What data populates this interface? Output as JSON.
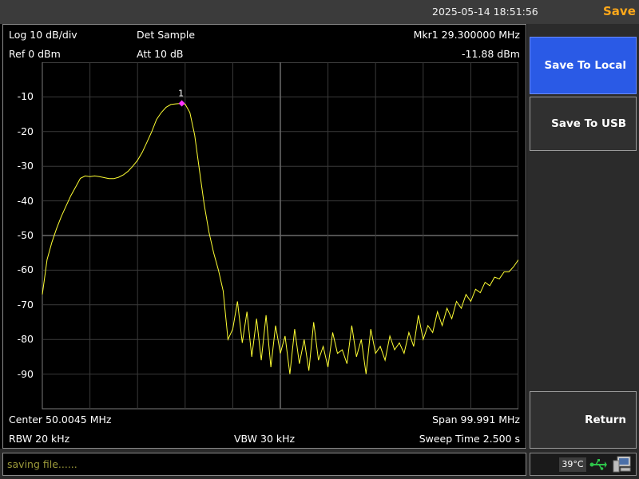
{
  "topbar": {
    "datetime": "2025-05-14 18:51:56",
    "menu_title": "Save"
  },
  "header": {
    "scale": "Log 10 dB/div",
    "detector": "Det Sample",
    "marker_label": "Mkr1  29.300000 MHz",
    "ref_level": "Ref 0 dBm",
    "attenuation": "Att 10 dB",
    "marker_value": "-11.88 dBm"
  },
  "footer": {
    "center": "Center 50.0045 MHz",
    "span": "Span 99.991 MHz",
    "rbw": "RBW 20 kHz",
    "vbw": "VBW 30 kHz",
    "sweep": "Sweep Time 2.500 s"
  },
  "softkeys": {
    "save_to_local": "Save To Local",
    "save_to_usb": "Save To USB",
    "return": "Return"
  },
  "status": {
    "message": "saving file......",
    "temperature": "39°C"
  },
  "icons": {
    "usb": "usb-icon",
    "pc": "computer-icon"
  },
  "colors": {
    "trace": "#ffff33",
    "marker": "#ff33ff",
    "accent": "#ffa81a",
    "selected_key": "#2a5ae6"
  },
  "chart_data": {
    "type": "line",
    "y_tick_labels": [
      "-10",
      "-20",
      "-30",
      "-40",
      "-50",
      "-60",
      "-70",
      "-80",
      "-90"
    ],
    "ylim": [
      -100,
      0
    ],
    "xlim_mhz": [
      0.009,
      100.0
    ],
    "grid": true,
    "marker": {
      "label": "1",
      "x_mhz": 29.3,
      "y_dbm": -11.88
    },
    "series": [
      {
        "x": [
          0.009,
          1,
          2,
          3,
          4,
          5,
          6,
          7,
          8,
          9,
          10,
          11,
          12,
          13,
          14,
          15,
          16,
          17,
          18,
          19,
          20,
          21,
          22,
          23,
          24,
          25,
          26,
          27,
          28,
          29,
          30,
          31,
          32,
          33,
          34,
          35,
          36,
          37,
          38,
          39,
          40,
          41,
          42,
          43,
          44,
          45,
          46,
          47,
          48,
          49,
          50,
          51,
          52,
          53,
          54,
          55,
          56,
          57,
          58,
          59,
          60,
          61,
          62,
          63,
          64,
          65,
          66,
          67,
          68,
          69,
          70,
          71,
          72,
          73,
          74,
          75,
          76,
          77,
          78,
          79,
          80,
          81,
          82,
          83,
          84,
          85,
          86,
          87,
          88,
          89,
          90,
          91,
          92,
          93,
          94,
          95,
          96,
          97,
          98,
          99,
          100
        ],
        "y": [
          -67,
          -57,
          -52,
          -48,
          -44.5,
          -41.5,
          -38.5,
          -36,
          -33.5,
          -32.8,
          -33,
          -32.8,
          -33,
          -33.3,
          -33.6,
          -33.6,
          -33.2,
          -32.5,
          -31.5,
          -30,
          -28.3,
          -26,
          -23,
          -20,
          -16.5,
          -14.5,
          -13,
          -12.2,
          -12,
          -11.9,
          -12.1,
          -14.5,
          -21,
          -31,
          -41,
          -49,
          -55,
          -60,
          -66,
          -80,
          -77,
          -69,
          -81,
          -72,
          -85,
          -74,
          -86,
          -73,
          -88,
          -76,
          -84,
          -79,
          -90,
          -77,
          -87,
          -80,
          -89,
          -75,
          -86,
          -82,
          -88,
          -78,
          -84,
          -83,
          -87,
          -76,
          -85,
          -80,
          -90,
          -77,
          -84,
          -82,
          -86,
          -79,
          -83,
          -81,
          -84,
          -78,
          -82,
          -73,
          -80,
          -76,
          -78,
          -72,
          -76,
          -71,
          -74,
          -69,
          -71,
          -67,
          -69,
          -65.5,
          -66.5,
          -63.5,
          -64.5,
          -62,
          -62.5,
          -60.5,
          -60.5,
          -59,
          -57
        ]
      }
    ]
  }
}
